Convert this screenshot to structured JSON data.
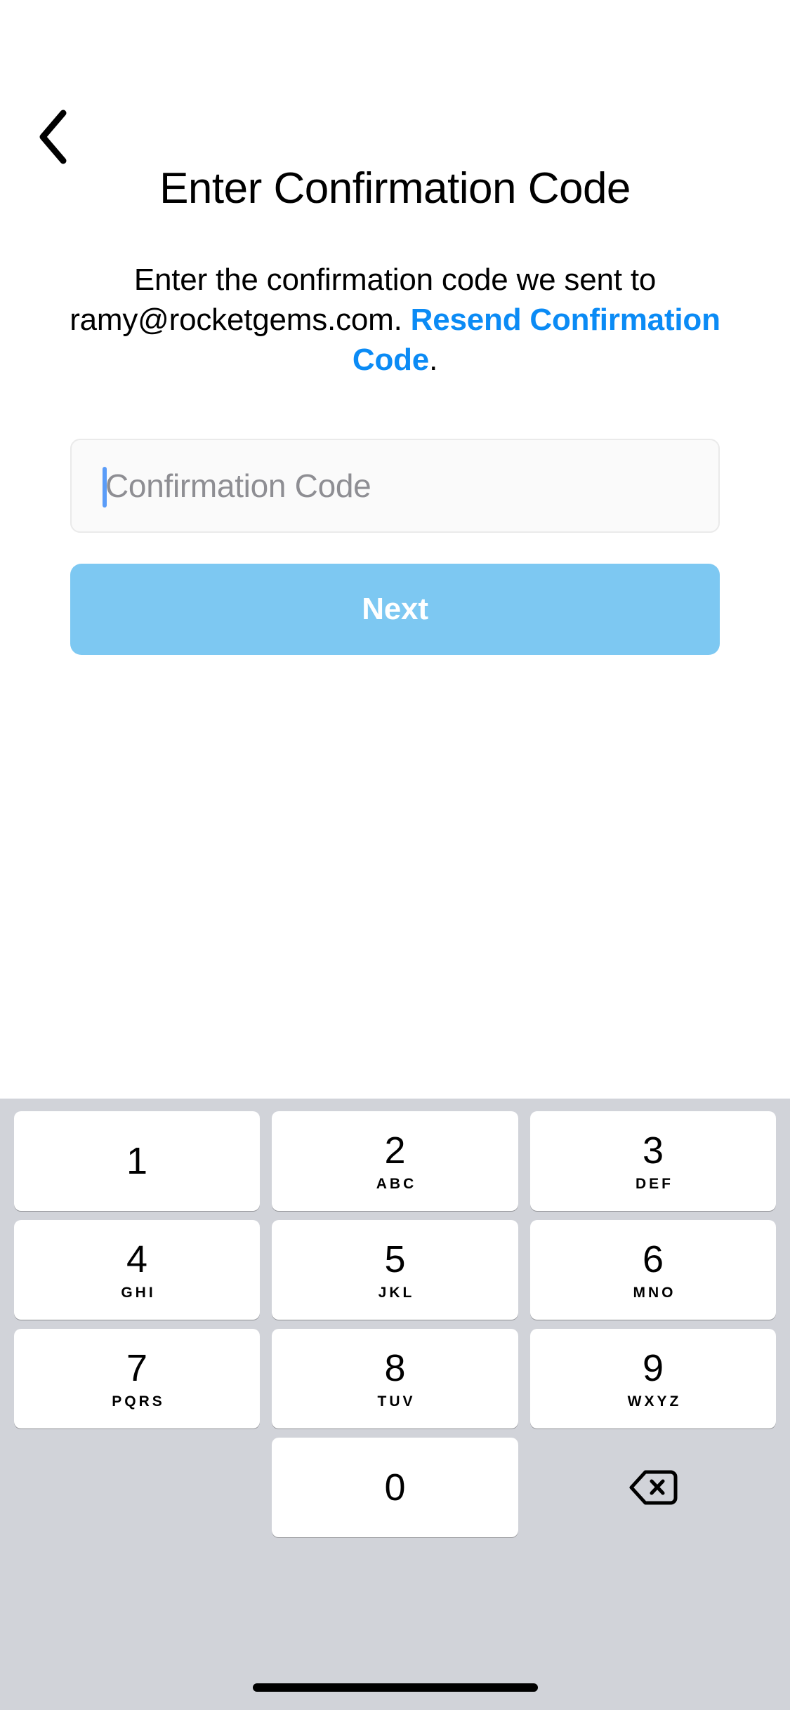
{
  "header": {
    "back_icon": "chevron-left-icon",
    "title": "Enter Confirmation Code"
  },
  "subtitle": {
    "lead": "Enter the confirmation code we sent to ramy@rocketgems.com. ",
    "email": "ramy@rocketgems.com",
    "link_label": "Resend Confirmation Code",
    "trailing": ".",
    "link_color": "#0b8bf5"
  },
  "form": {
    "code_input": {
      "value": "",
      "placeholder": "Confirmation Code",
      "caret_color": "#5a9cf8",
      "background": "#fafafa",
      "border_color": "#eaeaea"
    },
    "next_button": {
      "label": "Next",
      "background": "#7dc8f2",
      "text_color": "#ffffff"
    }
  },
  "keyboard": {
    "background": "#d1d3d9",
    "key_background": "#ffffff",
    "rows": [
      [
        {
          "digit": "1",
          "letters": ""
        },
        {
          "digit": "2",
          "letters": "ABC"
        },
        {
          "digit": "3",
          "letters": "DEF"
        }
      ],
      [
        {
          "digit": "4",
          "letters": "GHI"
        },
        {
          "digit": "5",
          "letters": "JKL"
        },
        {
          "digit": "6",
          "letters": "MNO"
        }
      ],
      [
        {
          "digit": "7",
          "letters": "PQRS"
        },
        {
          "digit": "8",
          "letters": "TUV"
        },
        {
          "digit": "9",
          "letters": "WXYZ"
        }
      ],
      [
        {
          "digit": "0",
          "letters": ""
        }
      ]
    ],
    "backspace_icon": "backspace-icon"
  },
  "system": {
    "home_indicator": "home-indicator"
  }
}
